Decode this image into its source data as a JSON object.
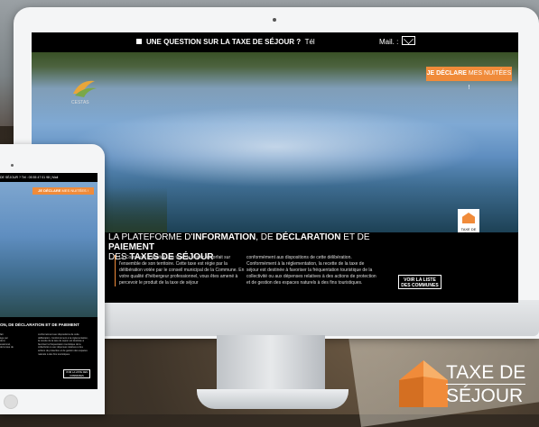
{
  "imac": {
    "topbar": {
      "question": "UNE QUESTION SUR LA TAXE DE SÉJOUR ?",
      "tel_label": "Tél",
      "mail_label": "Mail. :"
    },
    "declare_button": {
      "bold": "JE DÉCLARE",
      "rest": " MES NUITÉES !"
    },
    "badge_text": "TAXE DE SÉJOUR",
    "logo_text": "CESTAS",
    "headline": {
      "p1": "LA PLATEFORME D'",
      "b1": "INFORMATION",
      "p2": ", DE ",
      "b2": "DÉCLARATION",
      "p3": " ET DE ",
      "b3": "PAIEMENT",
      "p4": "DES ",
      "b4": "TAXES DE SÉJOUR"
    },
    "col1": "La Commune a institué une taxe de séjour au forfait sur l'ensemble de son territoire. Cette taxe est régie par la délibération votée par le conseil municipal de la Commune. En votre qualité d'hébergeur professionnel, vous êtes amené à percevoir le produit de la taxe de séjour",
    "col2": "conformément aux dispositions de cette délibération. Conformément à la réglementation, la recette de la taxe de séjour est destinée à favoriser la fréquentation touristique de la collectivité ou aux dépenses relatives à des actions de protection et de gestion des espaces naturels à des fins touristiques.",
    "list_button": "VOIR LA LISTE DES COMMUNES"
  },
  "ipad": {
    "bar": "DE SÉJOUR ? Tél : 05 55 47 01 98  |  Mail",
    "declare_button": {
      "bold": "JE DÉCLARE",
      "rest": " MES NUITÉES !"
    },
    "headline": "ON, DE DÉCLARATION ET DE PAIEMENT",
    "col1": "fait\nège par\nde la\nessionnel,\nde la taxe de",
    "col2": "conformément aux dispositions de cette délibération. Conformément à la réglementation, la recette de la taxe de séjour est destinée à favoriser la fréquentation touristique de la collectivité ou aux dépenses relatives à des actions de protection et de gestion des espaces naturels à des fins touristiques.",
    "list_button": "VOIR LA LISTE DES COMMUNES"
  },
  "brand": {
    "line1": "TAXE DE",
    "line2": "SÉJOUR"
  },
  "colors": {
    "accent": "#f08b3a",
    "black": "#000000"
  }
}
